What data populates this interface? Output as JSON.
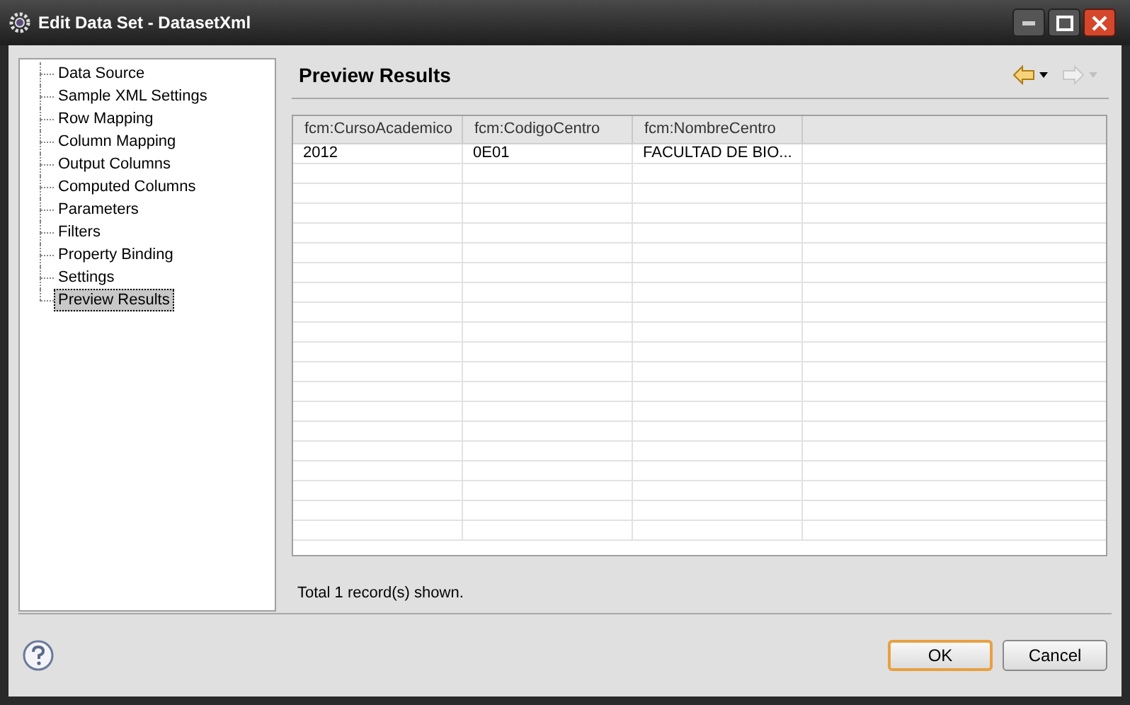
{
  "window": {
    "title": "Edit Data Set - DatasetXml"
  },
  "sidebar": {
    "items": [
      {
        "label": "Data Source",
        "selected": false
      },
      {
        "label": "Sample XML Settings",
        "selected": false
      },
      {
        "label": "Row Mapping",
        "selected": false
      },
      {
        "label": "Column Mapping",
        "selected": false
      },
      {
        "label": "Output Columns",
        "selected": false
      },
      {
        "label": "Computed Columns",
        "selected": false
      },
      {
        "label": "Parameters",
        "selected": false
      },
      {
        "label": "Filters",
        "selected": false
      },
      {
        "label": "Property Binding",
        "selected": false
      },
      {
        "label": "Settings",
        "selected": false
      },
      {
        "label": "Preview Results",
        "selected": true
      }
    ]
  },
  "page": {
    "title": "Preview Results",
    "back_disabled": false,
    "forward_disabled": true
  },
  "table": {
    "columns": [
      "fcm:CursoAcademico",
      "fcm:CodigoCentro",
      "fcm:NombreCentro"
    ],
    "rows": [
      [
        "2012",
        "0E01",
        "FACULTAD DE BIO..."
      ]
    ]
  },
  "status": "Total 1 record(s) shown.",
  "buttons": [
    {
      "label": "OK",
      "default": true
    },
    {
      "label": "Cancel",
      "default": false
    }
  ]
}
